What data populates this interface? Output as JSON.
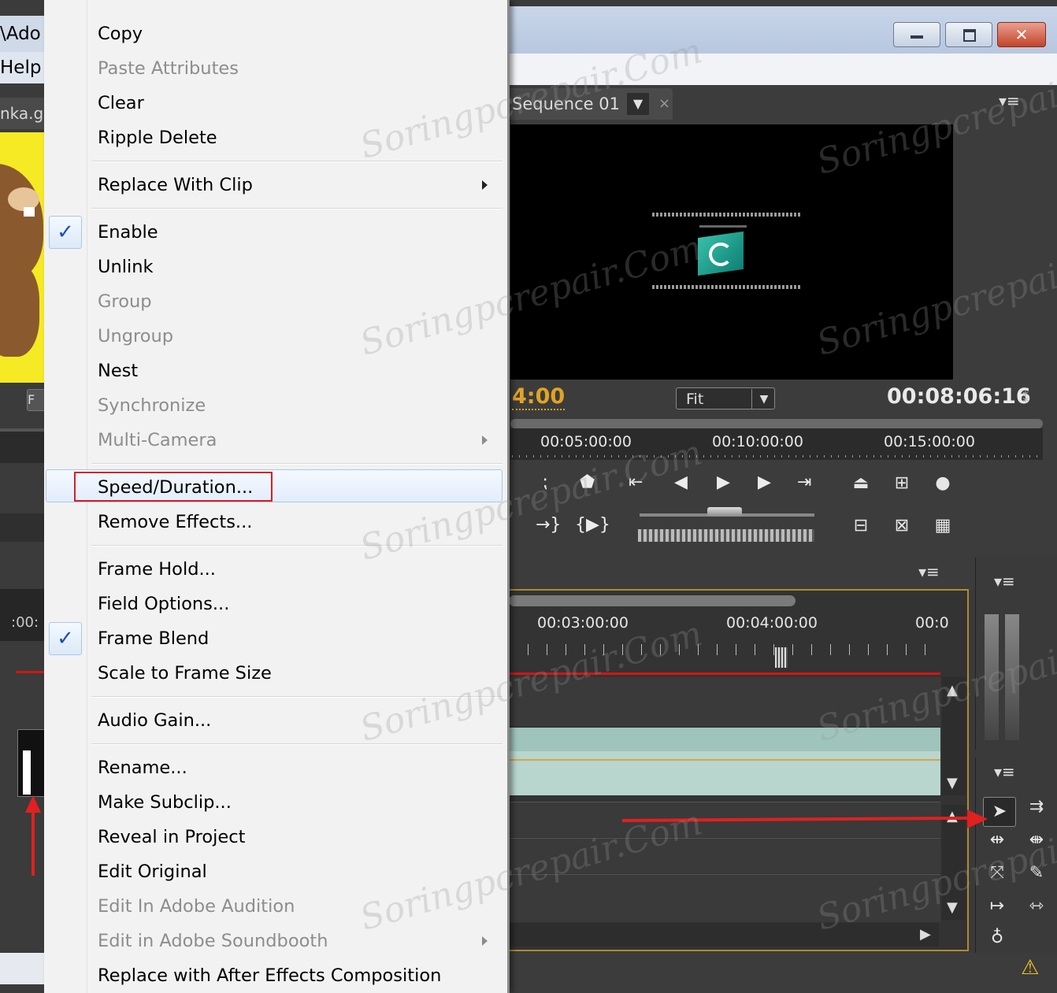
{
  "left_strip": {
    "title_fragment": "\\Ado",
    "menu_fragment": "Help",
    "tab_fragment": "nka.g",
    "ctrl_fragment": "F",
    "timeline_fragment": ":00:"
  },
  "monitor": {
    "tab_label": "Sequence 01",
    "tab_dropdown": "▼",
    "tab_close": "×",
    "panel_menu": "▾≡",
    "timecode_left": "4:00",
    "fit_label": "Fit",
    "fit_arrow": "▼",
    "timecode_right": "00:08:06:16",
    "ruler_labels": [
      "00:05:00:00",
      "00:10:00:00",
      "00:15:00:00"
    ]
  },
  "timeline": {
    "panel_menu": "▾≡",
    "ruler_labels": [
      "00:03:00:00",
      "00:04:00:00",
      "00:0"
    ]
  },
  "context_menu": {
    "items": [
      {
        "label": "Copy",
        "disabled": false
      },
      {
        "label": "Paste Attributes",
        "disabled": true
      },
      {
        "label": "Clear",
        "disabled": false
      },
      {
        "label": "Ripple Delete",
        "disabled": false
      },
      {
        "label": "Replace With Clip",
        "disabled": false,
        "submenu": true
      },
      {
        "label": "Enable",
        "disabled": false,
        "checked": true
      },
      {
        "label": "Unlink",
        "disabled": false
      },
      {
        "label": "Group",
        "disabled": true
      },
      {
        "label": "Ungroup",
        "disabled": true
      },
      {
        "label": "Nest",
        "disabled": false
      },
      {
        "label": "Synchronize",
        "disabled": true
      },
      {
        "label": "Multi-Camera",
        "disabled": true,
        "submenu": true
      },
      {
        "label": "Speed/Duration...",
        "disabled": false,
        "highlighted": true
      },
      {
        "label": "Remove Effects...",
        "disabled": false
      },
      {
        "label": "Frame Hold...",
        "disabled": false
      },
      {
        "label": "Field Options...",
        "disabled": false
      },
      {
        "label": "Frame Blend",
        "disabled": false,
        "checked": true
      },
      {
        "label": "Scale to Frame Size",
        "disabled": false
      },
      {
        "label": "Audio Gain...",
        "disabled": false
      },
      {
        "label": "Rename...",
        "disabled": false
      },
      {
        "label": "Make Subclip...",
        "disabled": false
      },
      {
        "label": "Reveal in Project",
        "disabled": false
      },
      {
        "label": "Edit Original",
        "disabled": false
      },
      {
        "label": "Edit In Adobe Audition",
        "disabled": true
      },
      {
        "label": "Edit in Adobe Soundbooth",
        "disabled": true,
        "submenu": true
      },
      {
        "label": "Replace with After Effects Composition",
        "disabled": false
      }
    ]
  },
  "watermark": "Soringpcrepair.Com",
  "colors": {
    "accent_timecode": "#e2a324",
    "highlight_border": "#d62020",
    "arrow": "#e12020",
    "clip": "#b8d5ce"
  }
}
